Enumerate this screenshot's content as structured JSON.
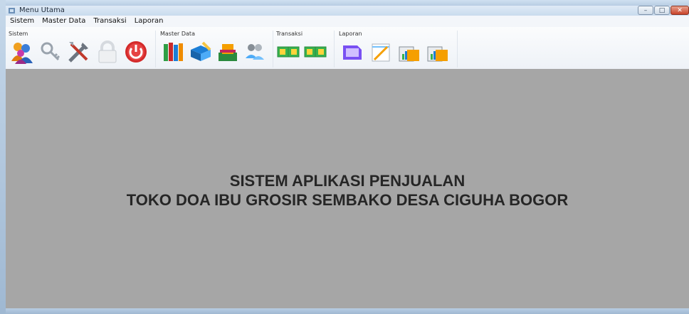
{
  "window": {
    "title": "Menu Utama",
    "minimize_glyph": "–",
    "maximize_glyph": "□",
    "close_glyph": "✕"
  },
  "menubar": {
    "items": [
      "Sistem",
      "Master Data",
      "Transaksi",
      "Laporan"
    ]
  },
  "toolbar": {
    "groups": [
      {
        "label": "Sistem",
        "icons": [
          "users-icon",
          "key-icon",
          "tools-icon",
          "lock-icon",
          "power-icon"
        ]
      },
      {
        "label": "Master Data",
        "icons": [
          "books-icon",
          "edit-book-icon",
          "inbox-tray-icon",
          "people-icon"
        ]
      },
      {
        "label": "Transaksi",
        "icons": [
          "transaction-icon-1",
          "transaction-icon-2"
        ]
      },
      {
        "label": "Laporan",
        "icons": [
          "report-icon",
          "notepad-icon",
          "chart-report-icon-1",
          "chart-report-icon-2"
        ]
      }
    ]
  },
  "content": {
    "line1": "SISTEM APLIKASI PENJUALAN",
    "line2": "TOKO DOA IBU GROSIR SEMBAKO DESA CIGUHA BOGOR",
    "background": "#a6a6a6"
  },
  "colors": {
    "accent_red": "#d32a2a",
    "toolbar_bg": "#f5f7fa"
  }
}
